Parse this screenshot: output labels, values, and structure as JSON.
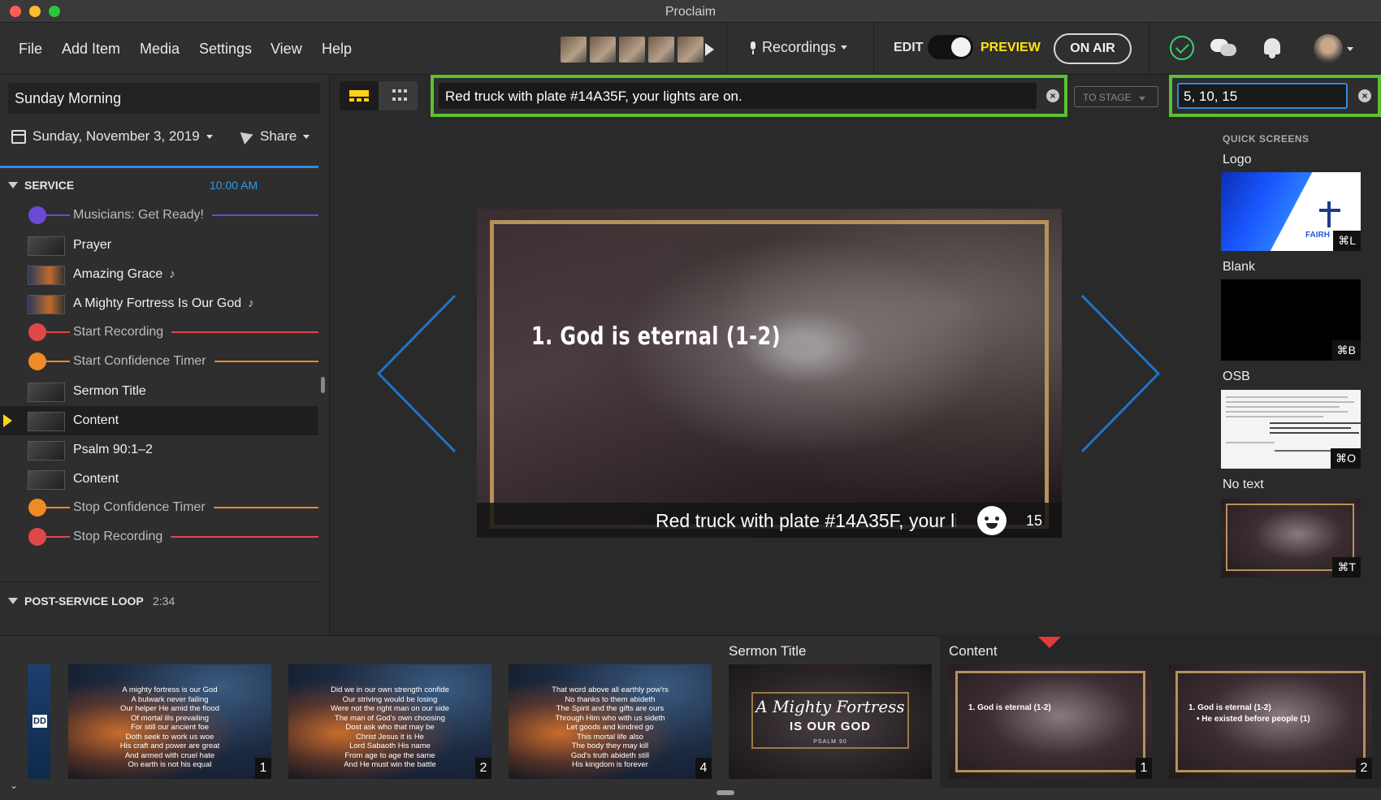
{
  "window": {
    "title": "Proclaim"
  },
  "menu": {
    "file": "File",
    "add_item": "Add Item",
    "media": "Media",
    "settings": "Settings",
    "view": "View",
    "help": "Help"
  },
  "toolbar": {
    "recordings": "Recordings",
    "edit": "EDIT",
    "preview": "PREVIEW",
    "on_air": "ON AIR"
  },
  "sidebar": {
    "plan_name": "Sunday Morning",
    "date": "Sunday, November 3, 2019",
    "share": "Share",
    "service": {
      "label": "SERVICE",
      "time": "10:00 AM"
    },
    "items": [
      {
        "label": "Musicians: Get Ready!",
        "kind": "cue",
        "color": "#6a4bd6"
      },
      {
        "label": "Prayer",
        "kind": "slide"
      },
      {
        "label": "Amazing Grace",
        "kind": "song",
        "note": "♪"
      },
      {
        "label": "A Mighty Fortress Is Our God",
        "kind": "song",
        "note": "♪"
      },
      {
        "label": "Start Recording",
        "kind": "cue",
        "color": "#e04848"
      },
      {
        "label": "Start Confidence Timer",
        "kind": "cue",
        "color": "#f08a24"
      },
      {
        "label": "Sermon Title",
        "kind": "slide"
      },
      {
        "label": "Content",
        "kind": "slide",
        "selected": true
      },
      {
        "label": "Psalm 90:1–2",
        "kind": "slide"
      },
      {
        "label": "Content",
        "kind": "slide"
      },
      {
        "label": "Stop Confidence Timer",
        "kind": "cue",
        "color": "#f08a24"
      },
      {
        "label": "Stop Recording",
        "kind": "cue",
        "color": "#e04848"
      }
    ],
    "post_loop": {
      "label": "POST-SERVICE LOOP",
      "time": "2:34"
    }
  },
  "message": {
    "text": "Red truck with plate #14A35F, your lights are on.",
    "to_stage": "TO STAGE",
    "numbers": "5, 10, 15"
  },
  "slide": {
    "title": "1. God is eternal (1-2)",
    "banner": "Red truck with plate #14A35F, your li",
    "counter": "15"
  },
  "quick_screens": {
    "heading": "QUICK SCREENS",
    "items": [
      {
        "label": "Logo",
        "key": "⌘L",
        "logo_text": "FAIRH"
      },
      {
        "label": "Blank",
        "key": "⌘B"
      },
      {
        "label": "OSB",
        "key": "⌘O"
      },
      {
        "label": "No text",
        "key": "⌘T"
      }
    ]
  },
  "filmstrip": {
    "partial_label": "DD",
    "slides": [
      {
        "num": "1",
        "lyric": "A mighty fortress is our God\nA bulwark never failing\nOur helper He amid the flood\nOf mortal ills prevailing\nFor still our ancient foe\nDoth seek to work us woe\nHis craft and power are great\nAnd armed with cruel hate\nOn earth is not his equal"
      },
      {
        "num": "2",
        "lyric": "Did we in our own strength confide\nOur striving would be losing\nWere not the right man on our side\nThe man of God's own choosing\nDost ask who that may be\nChrist Jesus it is He\nLord Sabaoth His name\nFrom age to age the same\nAnd He must win the battle"
      },
      {
        "num": "4",
        "lyric": "That word above all earthly pow'rs\nNo thanks to them abideth\nThe Spirit and the gifts are ours\nThrough Him who with us sideth\nLet goods and kindred go\nThis mortal life also\nThe body they may kill\nGod's truth abideth still\nHis kingdom is forever"
      }
    ],
    "sermon_group": "Sermon Title",
    "sermon": {
      "line1": "A Mighty Fortress",
      "line2": "IS OUR GOD",
      "line3": "PSALM 90"
    },
    "content_group": "Content",
    "content": [
      {
        "num": "1",
        "title": "1. God is eternal (1-2)",
        "bullet": ""
      },
      {
        "num": "2",
        "title": "1. God is eternal (1-2)",
        "bullet": "•  He existed before people (1)"
      }
    ]
  }
}
